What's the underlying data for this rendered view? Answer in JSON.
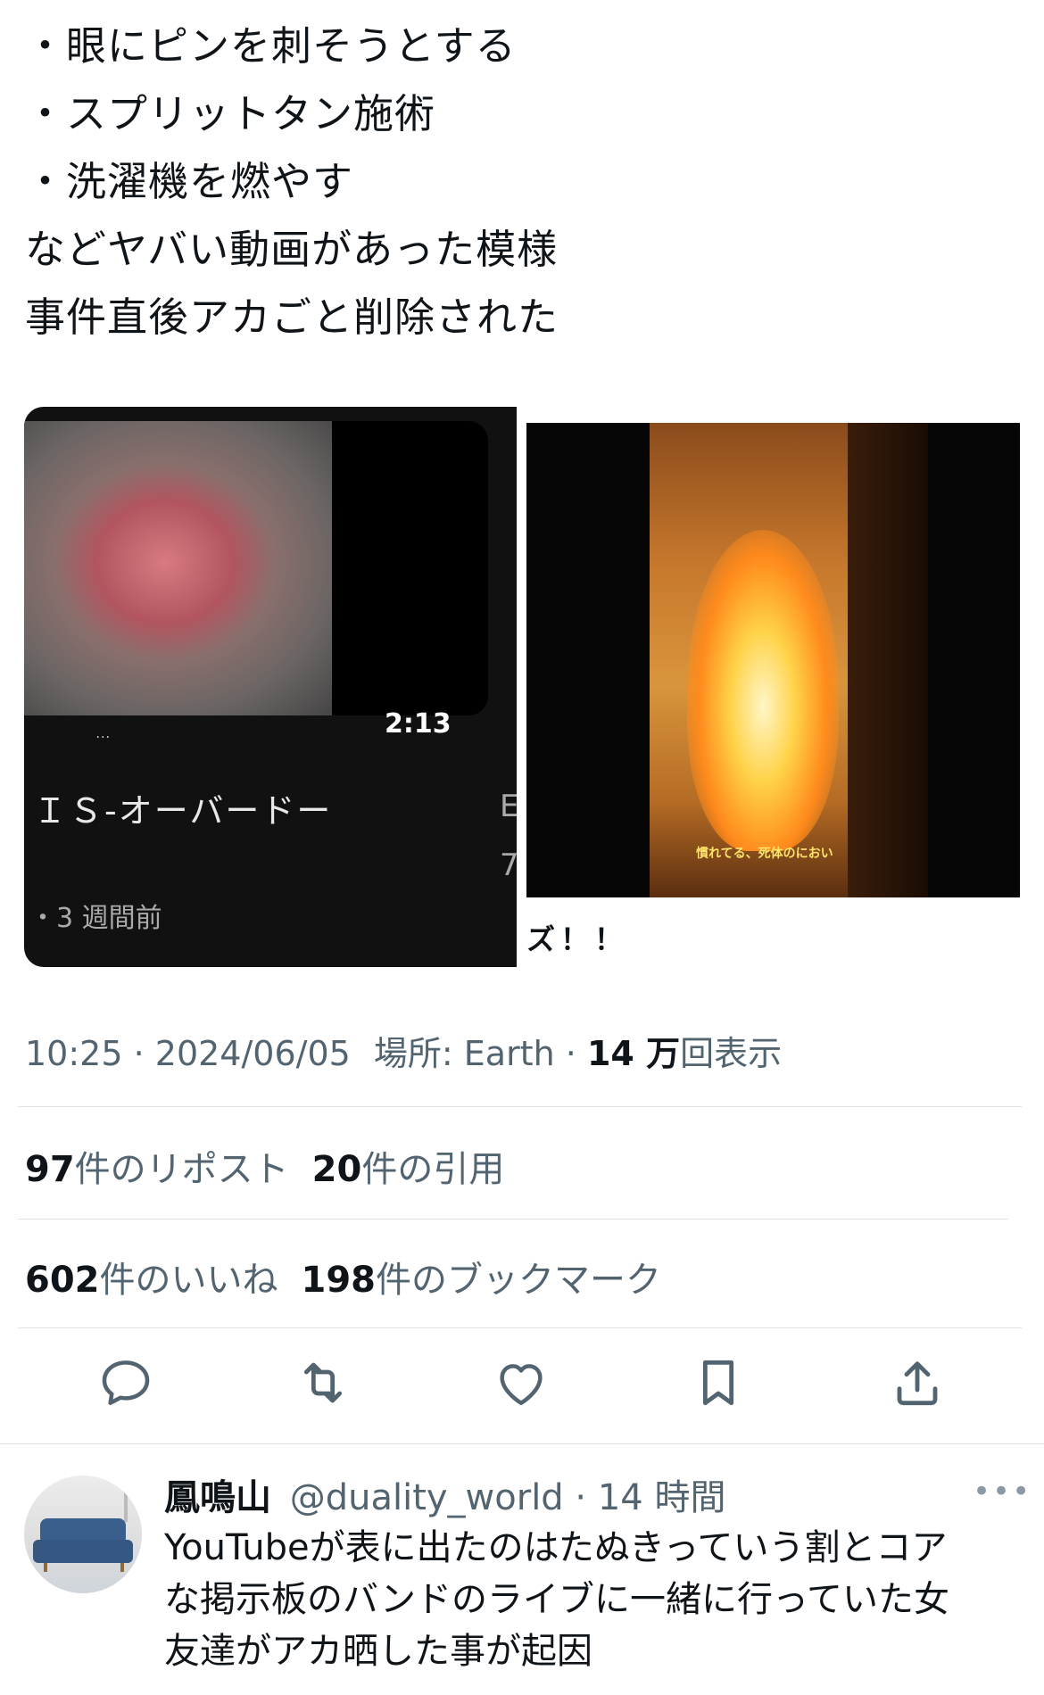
{
  "tweet": {
    "lines": [
      "・眼にピンを刺そうとする",
      "・スプリットタン施術",
      "・洗濯機を燃やす",
      "などヤバい動画があった模様",
      "事件直後アカごと削除された"
    ]
  },
  "media": {
    "left": {
      "duration": "2:13",
      "title": "ＩＳ‑オーバードー",
      "meta": "・3 週間前",
      "edge_char_1": "E",
      "edge_char_2": "7"
    },
    "right": {
      "caption": "慣れてる、死体のにおい",
      "below_text": "ズ！！"
    }
  },
  "meta": {
    "time": "10:25",
    "date": "2024/06/05",
    "location_label": "場所: Earth",
    "views_count": "14 万",
    "views_label": "回表示"
  },
  "stats": {
    "reposts_count": "97",
    "reposts_label": "件のリポスト",
    "quotes_count": "20",
    "quotes_label": "件の引用",
    "likes_count": "602",
    "likes_label": "件のいいね",
    "bookmarks_count": "198",
    "bookmarks_label": "件のブックマーク"
  },
  "actions": [
    "reply-icon",
    "retweet-icon",
    "like-icon",
    "bookmark-icon",
    "share-icon"
  ],
  "reply": {
    "name": "鳳鳴山",
    "handle": "@duality_world",
    "time": "14 時間",
    "more": "•••",
    "lines": [
      "YouTubeが表に出たのはたぬきっていう割とコア",
      "な掲示板のバンドのライブに一緒に行っていた女",
      "友達がアカ晒した事が起因"
    ]
  },
  "colors": {
    "text": "#0f1419",
    "secondary": "#536471",
    "icon": "#536471",
    "divider": "#dde2e6"
  }
}
